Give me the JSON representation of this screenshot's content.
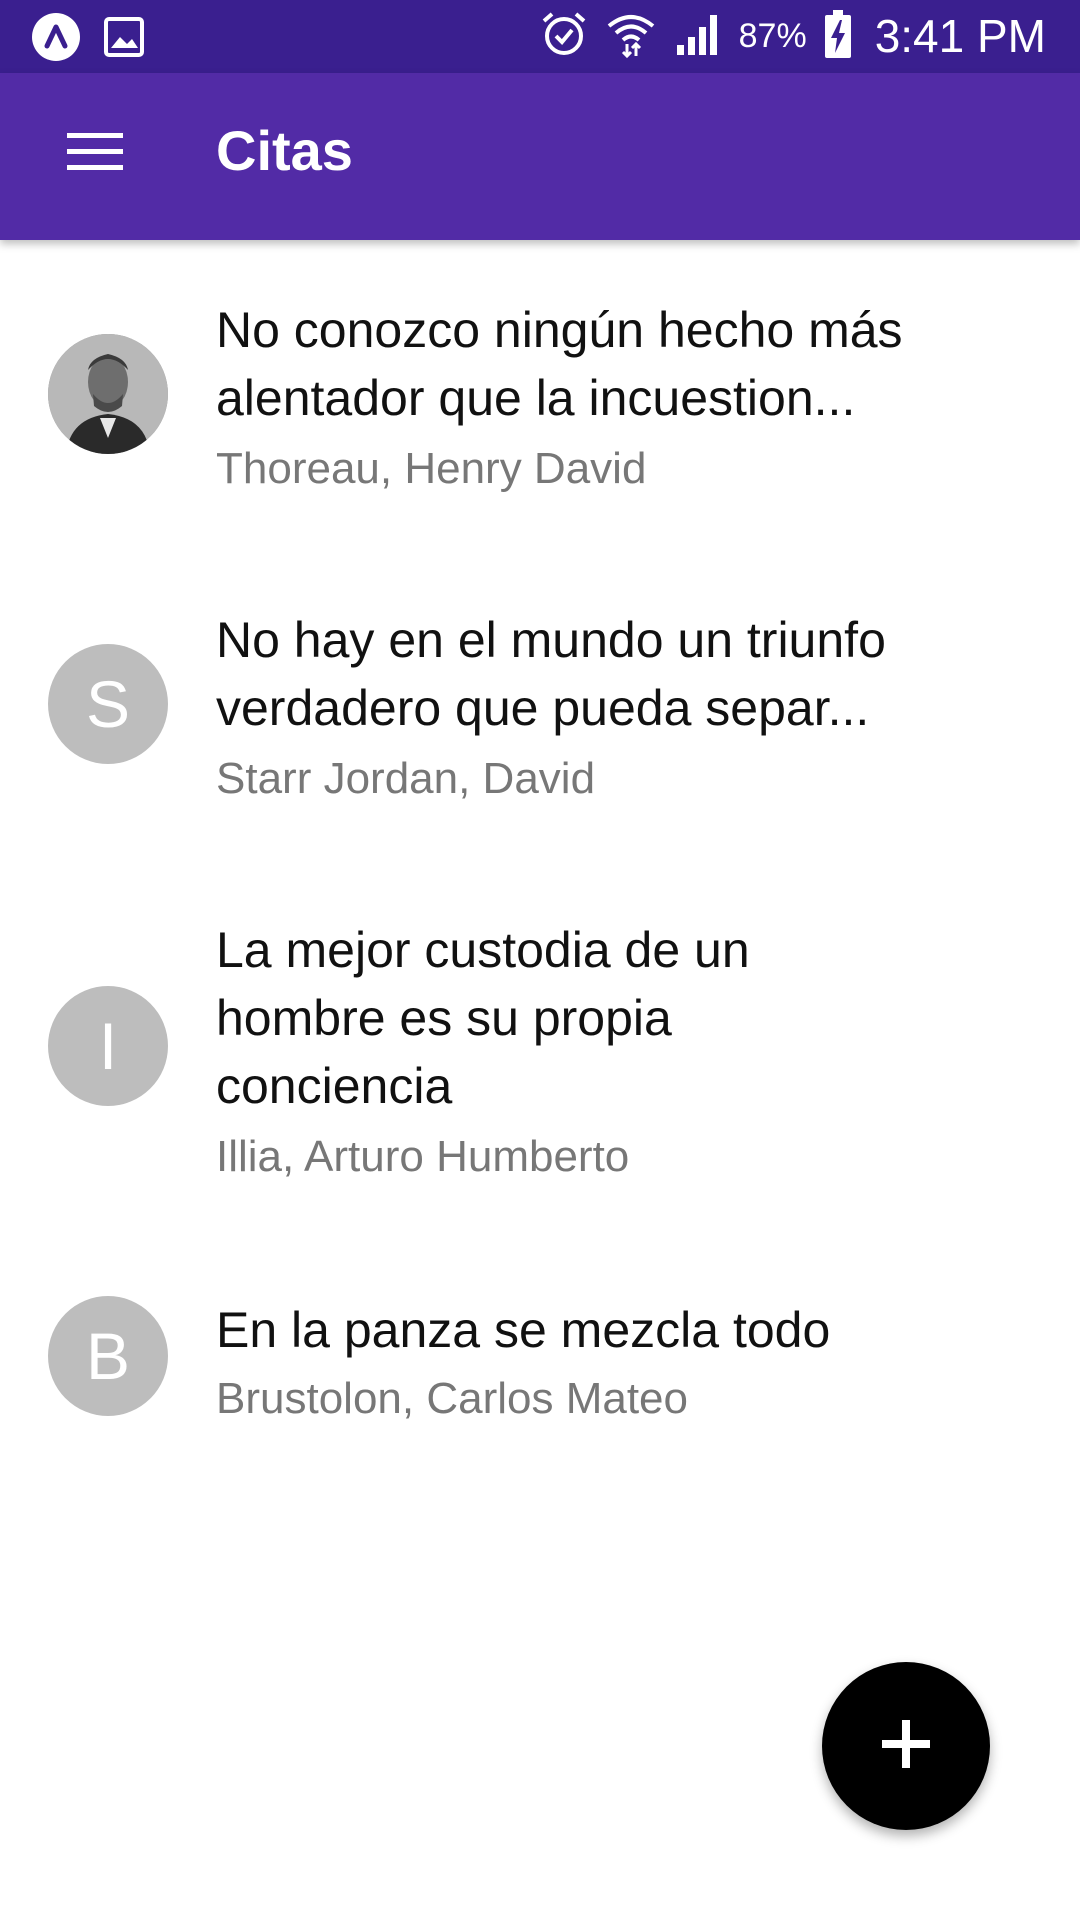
{
  "status_bar": {
    "battery_percent": "87%",
    "time": "3:41 PM",
    "icons": [
      "app-logo-icon",
      "image-icon",
      "alarm-icon",
      "wifi-icon",
      "signal-icon",
      "battery-charging-icon"
    ]
  },
  "app_bar": {
    "title": "Citas",
    "menu_icon": "hamburger-menu-icon",
    "color": "#522ba6"
  },
  "quotes": [
    {
      "avatar_letter": "",
      "avatar_type": "photo",
      "text": "No conozco ningún hecho más alentador que la incuestion...",
      "author": "Thoreau, Henry David"
    },
    {
      "avatar_letter": "S",
      "avatar_type": "letter",
      "text": "No hay en el mundo un triunfo verdadero que pueda separ...",
      "author": "Starr Jordan, David"
    },
    {
      "avatar_letter": "I",
      "avatar_type": "letter",
      "text": "La mejor custodia de un hombre es su propia conciencia",
      "author": "Illia, Arturo Humberto"
    },
    {
      "avatar_letter": "B",
      "avatar_type": "letter",
      "text": "En la panza se mezcla todo",
      "author": "Brustolon, Carlos Mateo"
    }
  ],
  "fab": {
    "label": "+",
    "icon": "plus-icon"
  }
}
